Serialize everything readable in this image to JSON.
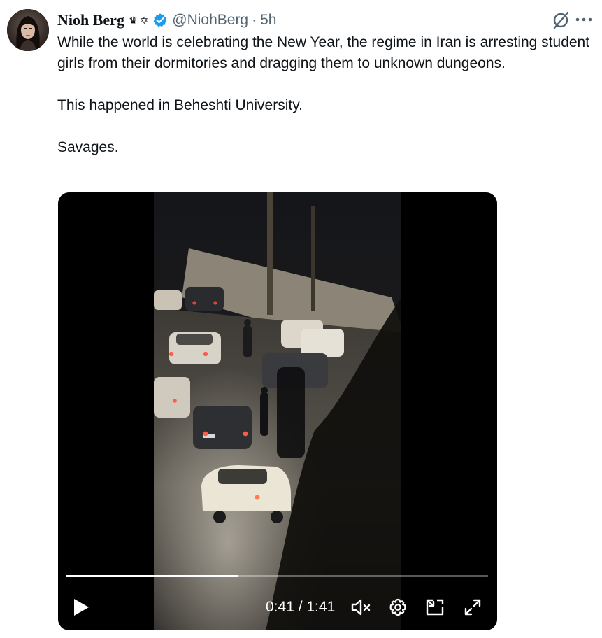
{
  "author": {
    "display_name": "Nioh Berg",
    "badge_glyphs": [
      "♛",
      "✡"
    ],
    "handle": "@NiohBerg",
    "separator": "·",
    "time": "5h"
  },
  "tweet": {
    "paragraphs": [
      "While the world is celebrating the New Year, the regime in Iran is arresting student girls from their dormitories and dragging them to unknown dungeons.",
      "This happened in Beheshti University.",
      "Savages."
    ]
  },
  "video": {
    "elapsed": "0:41",
    "duration": "1:41",
    "timecode": "0:41 / 1:41",
    "progress_fraction": 0.406
  },
  "colors": {
    "text": "#0f1419",
    "muted": "#536471",
    "verified": "#1d9bf0",
    "media_bg": "#000000"
  },
  "icons": [
    "verified-badge-icon",
    "grok-icon",
    "more-icon",
    "play-icon",
    "volume-muted-icon",
    "settings-icon",
    "dock-icon",
    "fullscreen-icon"
  ]
}
